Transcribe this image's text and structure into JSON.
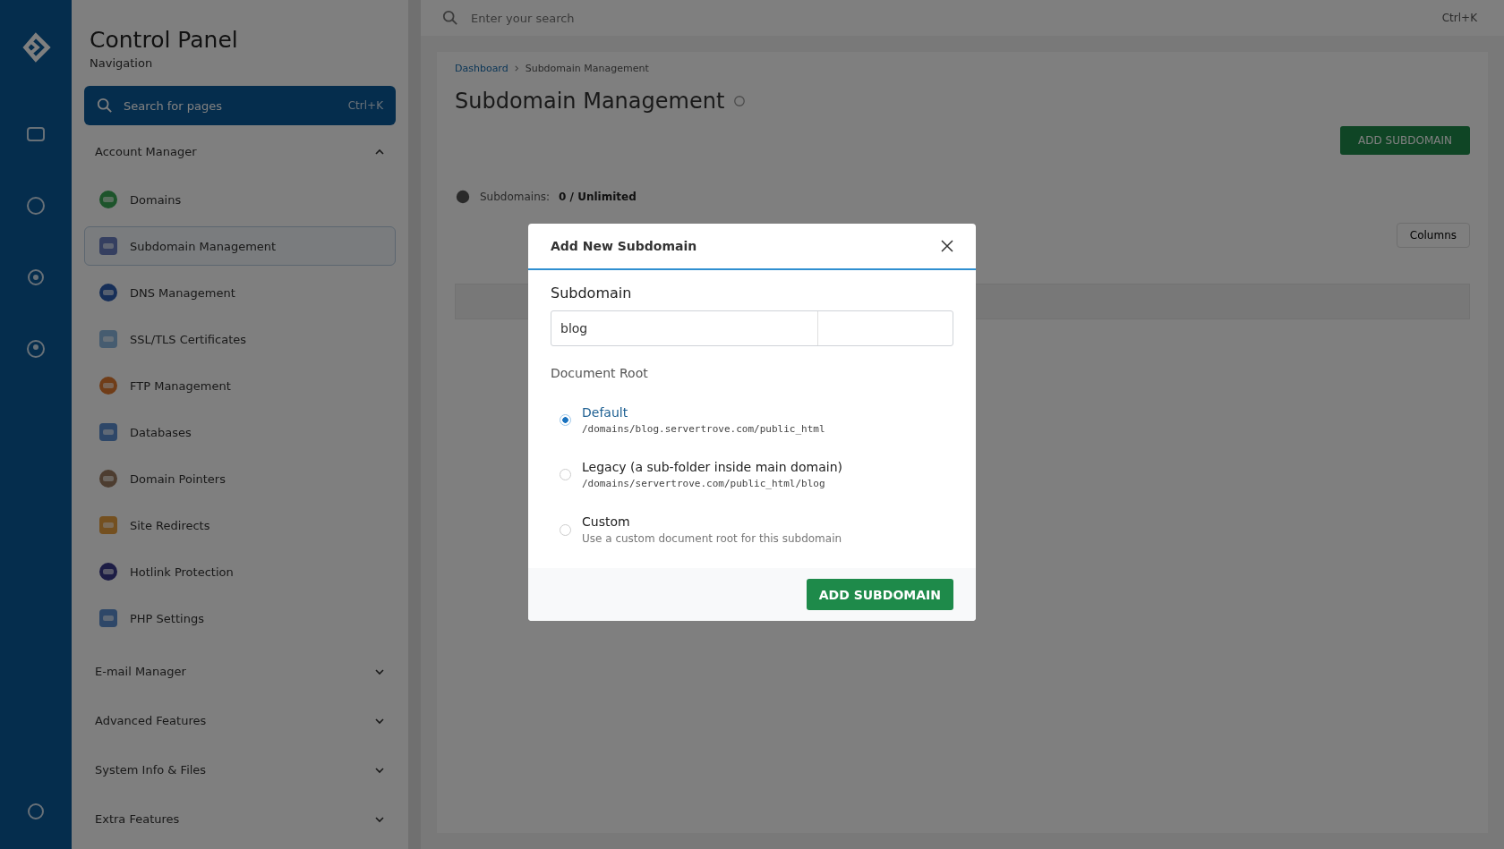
{
  "sidebar": {
    "title": "Control Panel",
    "subtitle": "Navigation",
    "search": {
      "placeholder": "Search for pages",
      "shortcut": "Ctrl+K"
    },
    "sections": [
      {
        "label": "Account Manager",
        "expanded": true,
        "items": [
          {
            "label": "Domains",
            "selected": false
          },
          {
            "label": "Subdomain Management",
            "selected": true
          },
          {
            "label": "DNS Management",
            "selected": false
          },
          {
            "label": "SSL/TLS Certificates",
            "selected": false
          },
          {
            "label": "FTP Management",
            "selected": false
          },
          {
            "label": "Databases",
            "selected": false
          },
          {
            "label": "Domain Pointers",
            "selected": false
          },
          {
            "label": "Site Redirects",
            "selected": false
          },
          {
            "label": "Hotlink Protection",
            "selected": false
          },
          {
            "label": "PHP Settings",
            "selected": false
          }
        ]
      },
      {
        "label": "E-mail Manager",
        "expanded": false
      },
      {
        "label": "Advanced Features",
        "expanded": false
      },
      {
        "label": "System Info & Files",
        "expanded": false
      },
      {
        "label": "Extra Features",
        "expanded": false
      }
    ]
  },
  "topbar": {
    "search": {
      "placeholder": "Enter your search"
    },
    "shortcut": "Ctrl+K"
  },
  "page": {
    "breadcrumb": [
      "Dashboard",
      "Subdomain Management"
    ],
    "title": "Subdomain Management",
    "add_button": "ADD SUBDOMAIN",
    "stats": {
      "label": "Subdomains:",
      "value": "0 / Unlimited"
    },
    "columns_button": "Columns"
  },
  "dialog": {
    "title": "Add New Subdomain",
    "field_label": "Subdomain",
    "field_value": "blog",
    "group_label": "Document Root",
    "options": [
      {
        "label": "Default",
        "detail": "/domains/blog.servertrove.com/public_html",
        "kind": "path",
        "selected": true
      },
      {
        "label": "Legacy (a sub-folder inside main domain)",
        "detail": "/domains/servertrove.com/public_html/blog",
        "kind": "path",
        "selected": false
      },
      {
        "label": "Custom",
        "detail": "Use a custom document root for this subdomain",
        "kind": "hint",
        "selected": false
      }
    ],
    "submit": "ADD SUBDOMAIN"
  }
}
